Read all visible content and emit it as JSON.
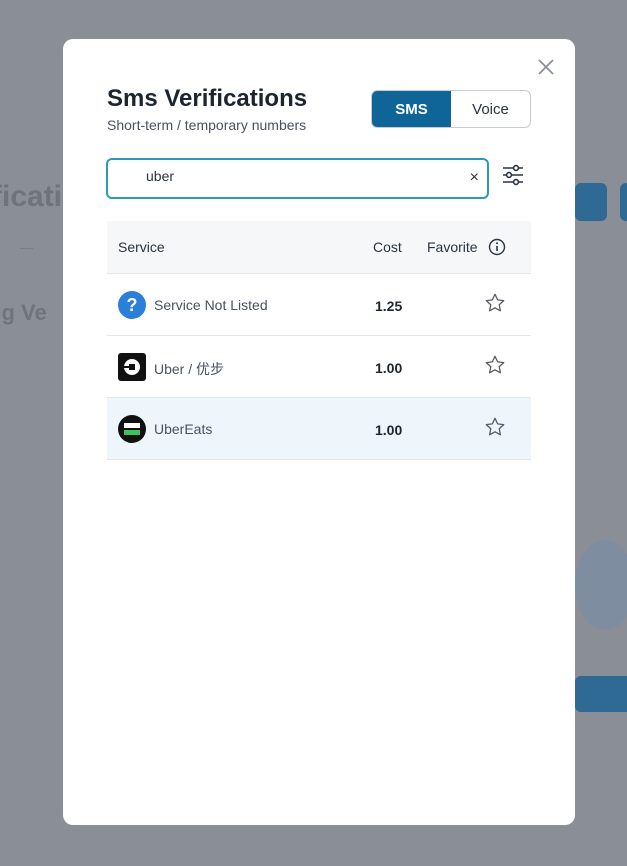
{
  "modal": {
    "title": "Sms Verifications",
    "subtitle": "Short-term / temporary numbers",
    "tabs": [
      {
        "label": "SMS",
        "active": true
      },
      {
        "label": "Voice",
        "active": false
      }
    ]
  },
  "search": {
    "value": "uber",
    "clear_label": "×"
  },
  "table": {
    "columns": [
      "Service",
      "Cost",
      "Favorite"
    ],
    "rows": [
      {
        "name": "Service Not Listed",
        "cost": "1.25",
        "icon": "question-icon",
        "favorite": false
      },
      {
        "name": "Uber / 优步",
        "cost": "1.00",
        "icon": "uber-logo-icon",
        "favorite": false
      },
      {
        "name": "UberEats",
        "cost": "1.00",
        "icon": "ubereats-logo-icon",
        "favorite": false
      }
    ]
  },
  "colors": {
    "primary": "#0f6598",
    "focus": "#2c9ab4",
    "selected_row": "#eef6fb"
  }
}
